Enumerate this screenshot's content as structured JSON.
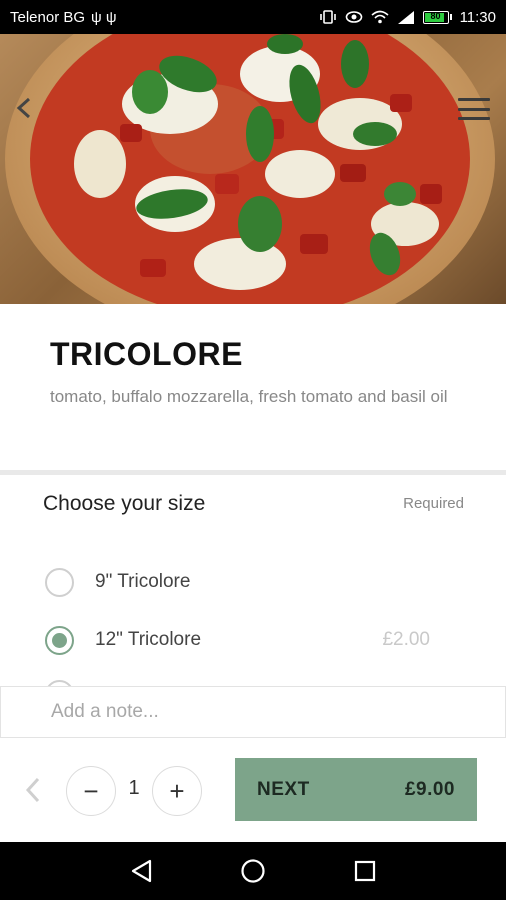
{
  "status_bar": {
    "carrier": "Telenor BG",
    "usb_icons": "ψ ψ",
    "battery_level": "80",
    "time": "11:30"
  },
  "product": {
    "title": "TRICOLORE",
    "description": "tomato, buffalo mozzarella, fresh tomato and basil oil"
  },
  "size": {
    "header": "Choose your size",
    "required_label": "Required",
    "options": [
      {
        "label": "9\" Tricolore",
        "price": "",
        "selected": false
      },
      {
        "label": "12\" Tricolore",
        "price": "£2.00",
        "selected": true
      }
    ]
  },
  "note": {
    "placeholder": "Add a note..."
  },
  "order": {
    "quantity": "1",
    "minus": "−",
    "plus": "+",
    "next_label": "NEXT",
    "next_price": "£9.00"
  },
  "colors": {
    "accent": "#7da48a",
    "text_muted": "#888888"
  }
}
